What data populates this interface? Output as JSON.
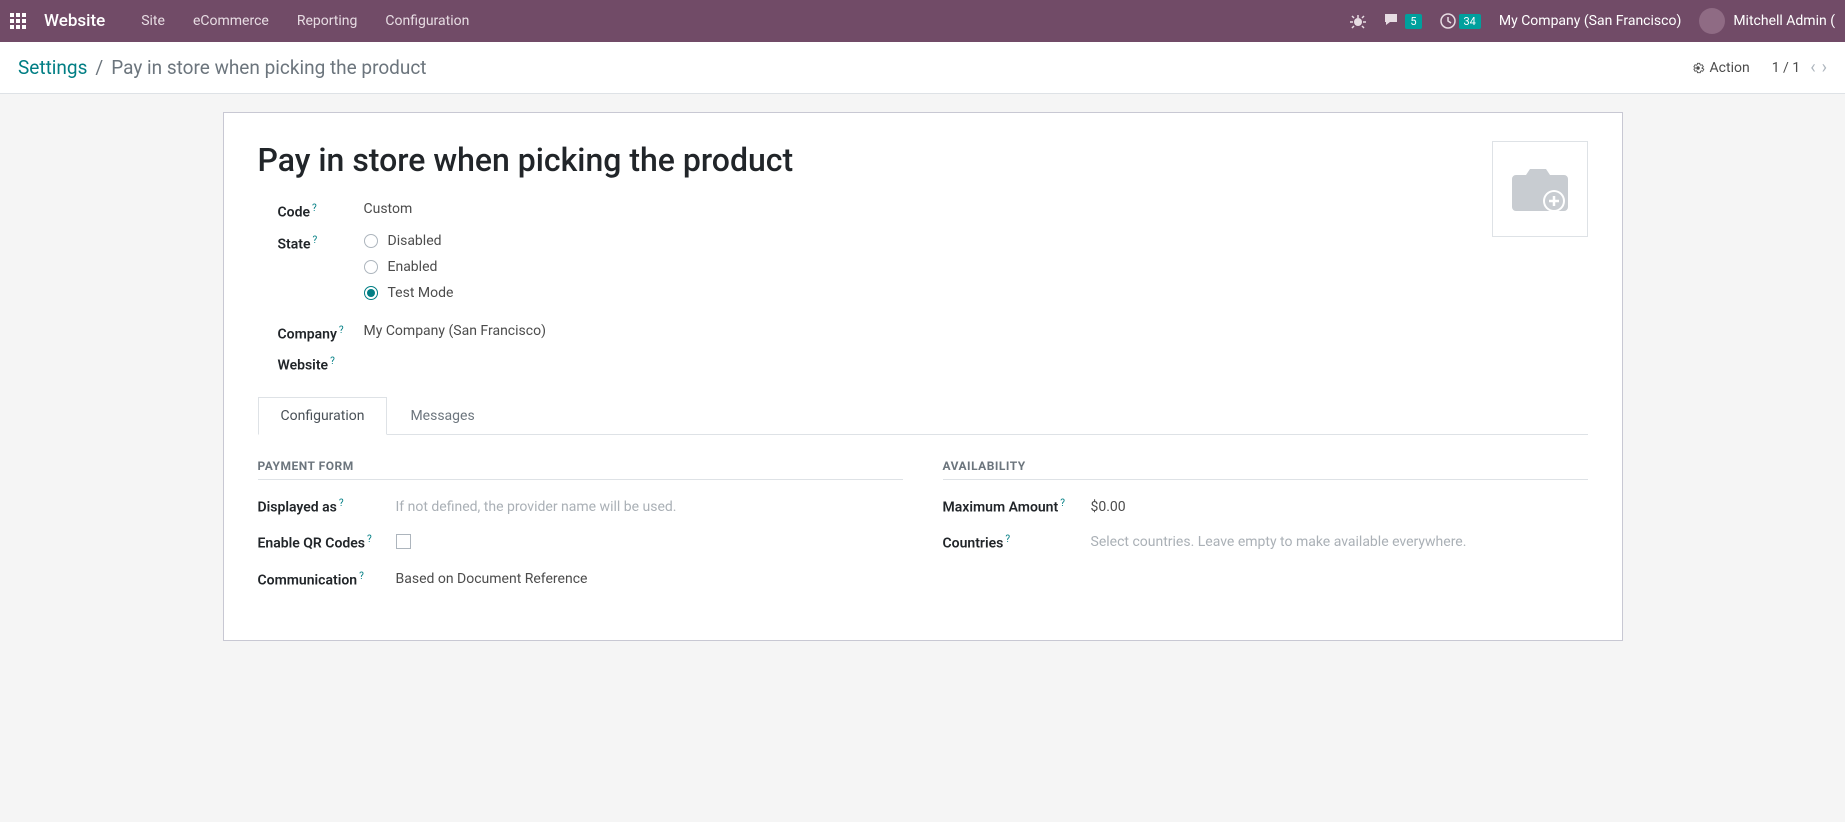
{
  "topbar": {
    "brand": "Website",
    "nav": [
      "Site",
      "eCommerce",
      "Reporting",
      "Configuration"
    ],
    "msg_count": "5",
    "activity_count": "34",
    "company": "My Company (San Francisco)",
    "user": "Mitchell Admin ("
  },
  "breadcrumb": {
    "parent": "Settings",
    "current": "Pay in store when picking the product",
    "action_label": "Action",
    "pager": "1 / 1"
  },
  "form": {
    "title": "Pay in store when picking the product",
    "fields": {
      "code_label": "Code",
      "code_value": "Custom",
      "state_label": "State",
      "state_options": [
        "Disabled",
        "Enabled",
        "Test Mode"
      ],
      "state_selected": "Test Mode",
      "company_label": "Company",
      "company_value": "My Company (San Francisco)",
      "website_label": "Website",
      "website_value": ""
    },
    "tabs": [
      "Configuration",
      "Messages"
    ],
    "payment_form": {
      "heading": "PAYMENT FORM",
      "displayed_as_label": "Displayed as",
      "displayed_as_placeholder": "If not defined, the provider name will be used.",
      "enable_qr_label": "Enable QR Codes",
      "enable_qr_checked": false,
      "communication_label": "Communication",
      "communication_value": "Based on Document Reference"
    },
    "availability": {
      "heading": "AVAILABILITY",
      "max_amount_label": "Maximum Amount",
      "max_amount_value": "$0.00",
      "countries_label": "Countries",
      "countries_placeholder": "Select countries. Leave empty to make available everywhere."
    }
  }
}
